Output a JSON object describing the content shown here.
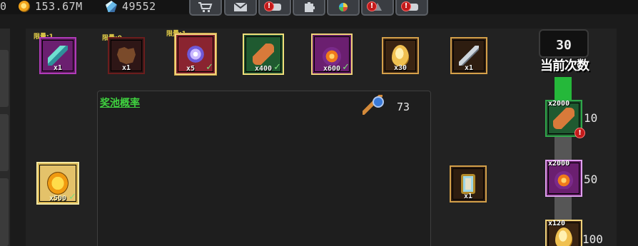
{
  "topbar": {
    "partial_value": "0",
    "gold": "153.67M",
    "gems": "49552",
    "buttons": [
      {
        "name": "shop-button",
        "icon": "cart-icon",
        "alert": false
      },
      {
        "name": "mail-button",
        "icon": "mail-icon",
        "alert": false
      },
      {
        "name": "event-button",
        "icon": "gamepad-icon",
        "alert": true
      },
      {
        "name": "puzzle-button",
        "icon": "puzzle-icon",
        "alert": false
      },
      {
        "name": "wheel-button",
        "icon": "color-wheel-icon",
        "alert": false
      },
      {
        "name": "tree-button",
        "icon": "tree-icon",
        "alert": true
      },
      {
        "name": "gamepad-button",
        "icon": "gamepad-icon",
        "alert": true
      }
    ],
    "alert_mark": "!"
  },
  "rewards": {
    "top_row": [
      {
        "name": "feather-item",
        "count": "x1",
        "limit": "限量:1",
        "claimed": false
      },
      {
        "name": "leather-item",
        "count": "x1",
        "limit": "限量:0",
        "claimed": false
      },
      {
        "name": "star-item",
        "count": "x5",
        "limit": "限量:1",
        "claimed": true
      },
      {
        "name": "bone-item",
        "count": "x400",
        "claimed": true
      },
      {
        "name": "flame-item",
        "count": "x600",
        "claimed": true
      },
      {
        "name": "egg-item",
        "count": "x30",
        "claimed": false
      },
      {
        "name": "knife-item",
        "count": "x1",
        "claimed": false
      }
    ],
    "coin_item": {
      "count": "x500",
      "claimed": true
    },
    "scroll_item": {
      "count": "x1"
    }
  },
  "pool": {
    "title": "奖池概率",
    "wand_count": "73"
  },
  "counter": {
    "value": "30",
    "label": "当前次数"
  },
  "milestones": [
    {
      "threshold": "10",
      "reward_count": "x2000",
      "icon": "bone-icon",
      "alert": true
    },
    {
      "threshold": "50",
      "reward_count": "x2000",
      "icon": "flame-icon",
      "alert": false
    },
    {
      "threshold": "100",
      "reward_count": "x120",
      "icon": "egg-icon",
      "alert": false
    }
  ],
  "check_mark": "✓",
  "colors": {
    "pool_title": "#3fd13f",
    "progress_fill": "#25b83a",
    "limit_text": "#e8d24a"
  }
}
